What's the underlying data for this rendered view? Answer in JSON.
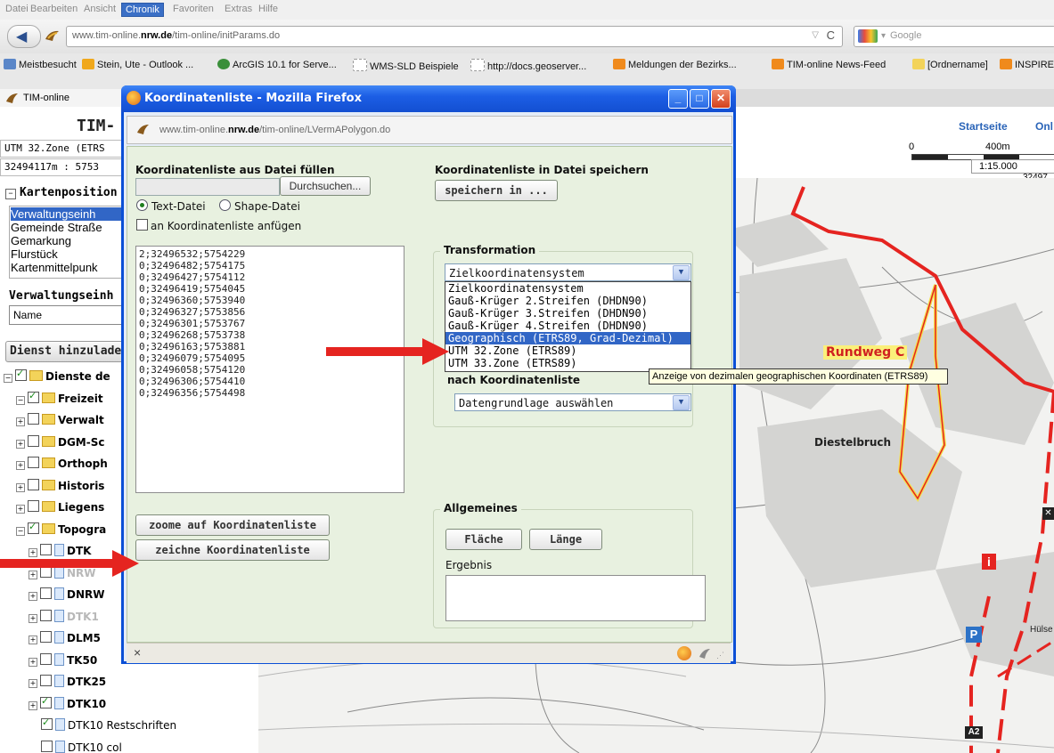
{
  "browser": {
    "menu": [
      "Datei",
      "Bearbeiten",
      "Ansicht",
      "Chronik",
      "Favoriten",
      "Extras",
      "Hilfe"
    ],
    "active_menu": "Chronik",
    "url_prefix": "www.tim-online.",
    "url_domain": "nrw.de",
    "url_path": "/tim-online/initParams.do",
    "search_placeholder": "Google",
    "bookmarks": [
      "Meistbesucht",
      "Stein, Ute - Outlook ...",
      "ArcGIS 10.1 for Serve...",
      "WMS-SLD Beispiele",
      "http://docs.geoserver...",
      "Meldungen der Bezirks...",
      "TIM-online News-Feed",
      "[Ordnername]",
      "INSPIRE"
    ],
    "tab_title": "TIM-online"
  },
  "left_panel": {
    "app_title": "TIM-",
    "crs_label": "UTM 32.Zone (ETRS",
    "coord_label": "32494117m : 5753",
    "section_kartenposition": "Kartenposition",
    "kartenposition_items": [
      "Verwaltungseinh",
      "Gemeinde Straße",
      "Gemarkung",
      "Flurstück",
      "Kartenmittelpunk"
    ],
    "section_verwaltung": "Verwaltungseinh",
    "name_field": "Name",
    "dienst_button": "Dienst hinzulade",
    "tree": [
      {
        "label": "Dienste de",
        "checked": true,
        "type": "folder",
        "indent": 0
      },
      {
        "label": "Freizeit",
        "checked": true,
        "type": "folder",
        "indent": 1
      },
      {
        "label": "Verwalt",
        "checked": false,
        "type": "folder",
        "indent": 1
      },
      {
        "label": "DGM-Sc",
        "checked": false,
        "type": "folder",
        "indent": 1
      },
      {
        "label": "Orthoph",
        "checked": false,
        "type": "folder",
        "indent": 1
      },
      {
        "label": "Historis",
        "checked": false,
        "type": "folder",
        "indent": 1
      },
      {
        "label": "Liegens",
        "checked": false,
        "type": "folder",
        "indent": 1
      },
      {
        "label": "Topogra",
        "checked": true,
        "type": "folder",
        "indent": 1
      },
      {
        "label": "DTK",
        "checked": false,
        "type": "page",
        "indent": 2
      },
      {
        "label": "NRW",
        "checked": false,
        "type": "page",
        "indent": 2,
        "faded": true
      },
      {
        "label": "DNRW",
        "checked": false,
        "type": "page",
        "indent": 2
      },
      {
        "label": "DTK1",
        "checked": false,
        "type": "page",
        "indent": 2,
        "faded": true
      },
      {
        "label": "DLM5",
        "checked": false,
        "type": "page",
        "indent": 2
      },
      {
        "label": "TK50",
        "checked": false,
        "type": "page",
        "indent": 2
      },
      {
        "label": "DTK25",
        "checked": false,
        "type": "page",
        "indent": 2
      },
      {
        "label": "DTK10",
        "checked": true,
        "type": "page",
        "indent": 2
      },
      {
        "label": "DTK10 Restschriften",
        "checked": true,
        "type": "page",
        "indent": 3,
        "normal": true
      },
      {
        "label": "DTK10 col",
        "checked": false,
        "type": "page",
        "indent": 3,
        "normal": true
      }
    ]
  },
  "map_header": {
    "links": [
      "Startseite",
      "Onl"
    ],
    "scale_zero": "0",
    "scale_dist": "400m",
    "scale_ratio": "1:15.000",
    "coord_right": "32497"
  },
  "map": {
    "labels": [
      "Rundweg C",
      "Diestelbruch",
      "Hülse"
    ],
    "route_color": "#e52420"
  },
  "popup": {
    "title": "Koordinatenliste - Mozilla Firefox",
    "url_prefix": "www.tim-online.",
    "url_domain": "nrw.de",
    "url_path": "/tim-online/LVermAPolygon.do",
    "fill_heading": "Koordinatenliste aus Datei füllen",
    "browse_button": "Durchsuchen...",
    "radio_text": "Text-Datei",
    "radio_shape": "Shape-Datei",
    "append_checkbox": "an Koordinatenliste anfügen",
    "save_heading": "Koordinatenliste in Datei speichern",
    "save_button": "speichern in ...",
    "coordinates": [
      "2;32496532;5754229",
      "0;32496482;5754175",
      "0;32496427;5754112",
      "0;32496419;5754045",
      "0;32496360;5753940",
      "0;32496327;5753856",
      "0;32496301;5753767",
      "0;32496268;5753738",
      "0;32496163;5753881",
      "0;32496079;5754095",
      "0;32496058;5754120",
      "0;32496306;5754410",
      "0;32496356;5754498"
    ],
    "transformation_heading": "Transformation",
    "target_select": "Zielkoordinatensystem",
    "dropdown_options": [
      "Zielkoordinatensystem",
      "Gauß-Krüger 2.Streifen (DHDN90)",
      "Gauß-Krüger 3.Streifen (DHDN90)",
      "Gauß-Krüger 4.Streifen (DHDN90)",
      "Geographisch (ETRS89, Grad-Dezimal)",
      "UTM 32.Zone (ETRS89)",
      "UTM 33.Zone (ETRS89)"
    ],
    "selected_option_index": 4,
    "tooltip": "Anzeige von dezimalen geographischen Koordinaten (ETRS89)",
    "nach_heading": "nach Koordinatenliste",
    "datengrundlage_select": "Datengrundlage auswählen",
    "zoom_button": "zoome auf Koordinatenliste",
    "draw_button": "zeichne Koordinatenliste",
    "allgemeines_heading": "Allgemeines",
    "flaeche_button": "Fläche",
    "laenge_button": "Länge",
    "ergebnis_label": "Ergebnis",
    "status_close": "×"
  }
}
